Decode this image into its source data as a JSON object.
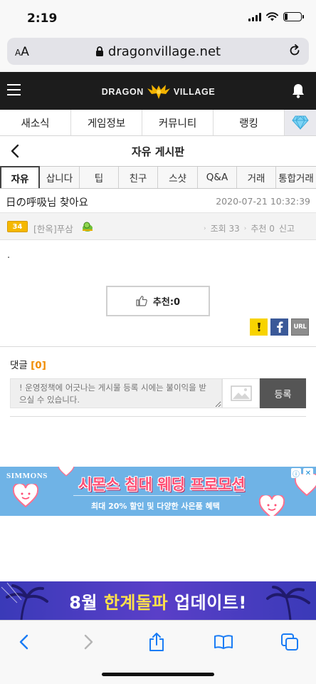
{
  "status_bar": {
    "time": "2:19",
    "battery_level": 0.2
  },
  "browser": {
    "text_size_label": "AA",
    "url": "dragonvillage.net"
  },
  "site": {
    "logo_left": "DRAGON",
    "logo_right": "VILLAGE"
  },
  "main_tabs": [
    {
      "label": "새소식"
    },
    {
      "label": "게임정보"
    },
    {
      "label": "커뮤니티"
    },
    {
      "label": "랭킹"
    }
  ],
  "board": {
    "title": "자유 게시판"
  },
  "sub_tabs": [
    {
      "label": "자유",
      "active": true
    },
    {
      "label": "삽니다"
    },
    {
      "label": "팁"
    },
    {
      "label": "친구"
    },
    {
      "label": "스샷"
    },
    {
      "label": "Q&A"
    },
    {
      "label": "거래"
    },
    {
      "label": "통합거래"
    }
  ],
  "post": {
    "title": "日の呼吸님 찾아요",
    "date": "2020-07-21 10:32:39",
    "level": "34",
    "author": "[한옥]푸삼",
    "views_label": "조회 33",
    "recommend_label": "추천 0",
    "report_label": "신고",
    "body": ".",
    "recommend_button": "추천:0"
  },
  "share": {
    "url_label": "URL"
  },
  "comments": {
    "title": "댓글",
    "count": "[0]",
    "placeholder": "! 운영정책에 어긋나는 게시물 등록 시에는 불이익을 받으실 수 있습니다.",
    "submit_label": "등록"
  },
  "ad": {
    "brand": "SIMMONS",
    "headline": "시몬스 침대 웨딩 프로모션",
    "subtext": "최대 20% 할인 및 다양한 사은품 혜택"
  },
  "promo": {
    "month": "8월",
    "highlight": "한계돌파",
    "suffix": "업데이트!"
  },
  "colors": {
    "header_bg": "#1c1c1c",
    "accent": "#f08c00",
    "level_badge": "#f5b800",
    "ad_bg": "#6fb3e6",
    "promo_bg": "#4a3cc0"
  }
}
